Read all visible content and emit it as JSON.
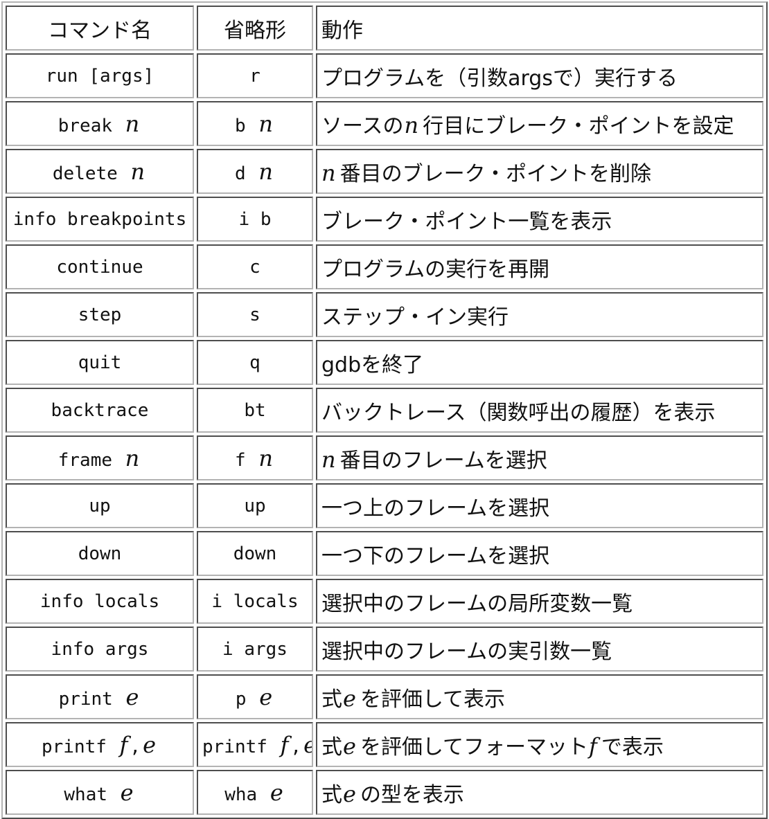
{
  "table": {
    "headers": {
      "command": "コマンド名",
      "abbreviation": "省略形",
      "action": "動作"
    },
    "rows": [
      {
        "command": [
          {
            "t": "run [args]",
            "var": false
          }
        ],
        "abbr": [
          {
            "t": "r",
            "var": false
          }
        ],
        "desc": [
          {
            "t": "プログラムを（引数argsで）実行する",
            "var": false
          }
        ]
      },
      {
        "command": [
          {
            "t": "break",
            "var": false
          },
          {
            "t": "n",
            "var": true
          }
        ],
        "abbr": [
          {
            "t": "b",
            "var": false
          },
          {
            "t": "n",
            "var": true
          }
        ],
        "desc": [
          {
            "t": "ソースの",
            "var": false
          },
          {
            "t": "n",
            "var": true
          },
          {
            "t": "行目にブレーク・ポイントを設定",
            "var": false
          }
        ]
      },
      {
        "command": [
          {
            "t": "delete",
            "var": false
          },
          {
            "t": "n",
            "var": true
          }
        ],
        "abbr": [
          {
            "t": "d",
            "var": false
          },
          {
            "t": "n",
            "var": true
          }
        ],
        "desc": [
          {
            "t": "n",
            "var": true
          },
          {
            "t": "番目のブレーク・ポイントを削除",
            "var": false
          }
        ]
      },
      {
        "command": [
          {
            "t": "info breakpoints",
            "var": false
          }
        ],
        "abbr": [
          {
            "t": "i b",
            "var": false
          }
        ],
        "desc": [
          {
            "t": "ブレーク・ポイント一覧を表示",
            "var": false
          }
        ]
      },
      {
        "command": [
          {
            "t": "continue",
            "var": false
          }
        ],
        "abbr": [
          {
            "t": "c",
            "var": false
          }
        ],
        "desc": [
          {
            "t": "プログラムの実行を再開",
            "var": false
          }
        ]
      },
      {
        "command": [
          {
            "t": "step",
            "var": false
          }
        ],
        "abbr": [
          {
            "t": "s",
            "var": false
          }
        ],
        "desc": [
          {
            "t": "ステップ・イン実行",
            "var": false
          }
        ]
      },
      {
        "command": [
          {
            "t": "quit",
            "var": false
          }
        ],
        "abbr": [
          {
            "t": "q",
            "var": false
          }
        ],
        "desc": [
          {
            "t": "gdbを終了",
            "var": false
          }
        ]
      },
      {
        "command": [
          {
            "t": "backtrace",
            "var": false
          }
        ],
        "abbr": [
          {
            "t": "bt",
            "var": false
          }
        ],
        "desc": [
          {
            "t": "バックトレース（関数呼出の履歴）を表示",
            "var": false
          }
        ]
      },
      {
        "command": [
          {
            "t": "frame",
            "var": false
          },
          {
            "t": "n",
            "var": true
          }
        ],
        "abbr": [
          {
            "t": "f",
            "var": false
          },
          {
            "t": "n",
            "var": true
          }
        ],
        "desc": [
          {
            "t": "n",
            "var": true
          },
          {
            "t": "番目のフレームを選択",
            "var": false
          }
        ]
      },
      {
        "command": [
          {
            "t": "up",
            "var": false
          }
        ],
        "abbr": [
          {
            "t": "up",
            "var": false
          }
        ],
        "desc": [
          {
            "t": "一つ上のフレームを選択",
            "var": false
          }
        ]
      },
      {
        "command": [
          {
            "t": "down",
            "var": false
          }
        ],
        "abbr": [
          {
            "t": "down",
            "var": false
          }
        ],
        "desc": [
          {
            "t": "一つ下のフレームを選択",
            "var": false
          }
        ]
      },
      {
        "command": [
          {
            "t": "info locals",
            "var": false
          }
        ],
        "abbr": [
          {
            "t": "i locals",
            "var": false
          }
        ],
        "desc": [
          {
            "t": "選択中のフレームの局所変数一覧",
            "var": false
          }
        ]
      },
      {
        "command": [
          {
            "t": "info args",
            "var": false
          }
        ],
        "abbr": [
          {
            "t": "i args",
            "var": false
          }
        ],
        "desc": [
          {
            "t": "選択中のフレームの実引数一覧",
            "var": false
          }
        ]
      },
      {
        "command": [
          {
            "t": "print",
            "var": false
          },
          {
            "t": "e",
            "var": true
          }
        ],
        "abbr": [
          {
            "t": "p",
            "var": false
          },
          {
            "t": "e",
            "var": true
          }
        ],
        "desc": [
          {
            "t": "式",
            "var": false
          },
          {
            "t": "e",
            "var": true
          },
          {
            "t": "を評価して表示",
            "var": false
          }
        ]
      },
      {
        "command": [
          {
            "t": "printf",
            "var": false
          },
          {
            "t": "f",
            "var": true
          },
          {
            "t": ",",
            "var": false
          },
          {
            "t": "e",
            "var": true
          }
        ],
        "abbr": [
          {
            "t": "printf",
            "var": false
          },
          {
            "t": "f",
            "var": true
          },
          {
            "t": ",",
            "var": false
          },
          {
            "t": "e",
            "var": true
          }
        ],
        "desc": [
          {
            "t": "式",
            "var": false
          },
          {
            "t": "e",
            "var": true
          },
          {
            "t": "を評価してフォーマット",
            "var": false
          },
          {
            "t": "f",
            "var": true
          },
          {
            "t": "で表示",
            "var": false
          }
        ]
      },
      {
        "command": [
          {
            "t": "what",
            "var": false
          },
          {
            "t": "e",
            "var": true
          }
        ],
        "abbr": [
          {
            "t": "wha",
            "var": false
          },
          {
            "t": "e",
            "var": true
          }
        ],
        "desc": [
          {
            "t": "式",
            "var": false
          },
          {
            "t": "e",
            "var": true
          },
          {
            "t": "の型を表示",
            "var": false
          }
        ]
      }
    ]
  }
}
